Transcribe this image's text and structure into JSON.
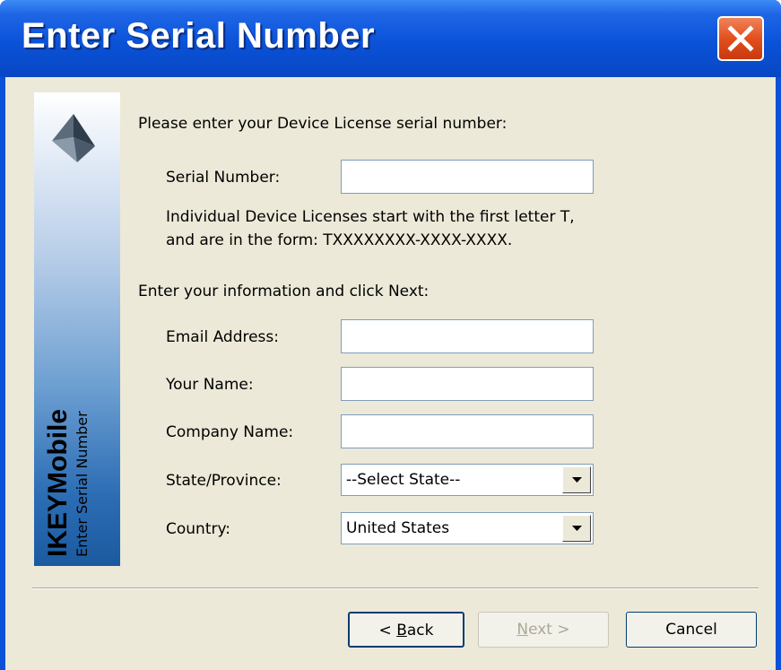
{
  "window": {
    "title": "Enter Serial Number"
  },
  "banner": {
    "product": "IKEYMobile",
    "subtitle": "Enter Serial Number"
  },
  "form": {
    "serial_prompt": "Please enter your Device License serial number:",
    "serial_label": "Serial Number:",
    "serial_value": "",
    "hint_line1": "Individual Device Licenses start with the first letter T,",
    "hint_line2": "and are in the form:  TXXXXXXXX-XXXX-XXXX.",
    "info_prompt": "Enter your information and click Next:",
    "email_label": "Email Address:",
    "email_value": "",
    "name_label": "Your Name:",
    "name_value": "",
    "company_label": "Company Name:",
    "company_value": "",
    "state_label": "State/Province:",
    "state_value": "--Select State--",
    "country_label": "Country:",
    "country_value": "United States"
  },
  "buttons": {
    "back_prefix": "< ",
    "back_accel": "B",
    "back_rest": "ack",
    "next_accel": "N",
    "next_rest": "ext >",
    "cancel": "Cancel",
    "next_enabled": false
  },
  "icons": {
    "close": "close-x-icon",
    "logo": "ikey-logo-icon",
    "dropdown": "dropdown-arrow-icon"
  },
  "colors": {
    "titlebar": "#0a52d8",
    "close": "#e2501e",
    "client": "#ece9d8"
  }
}
